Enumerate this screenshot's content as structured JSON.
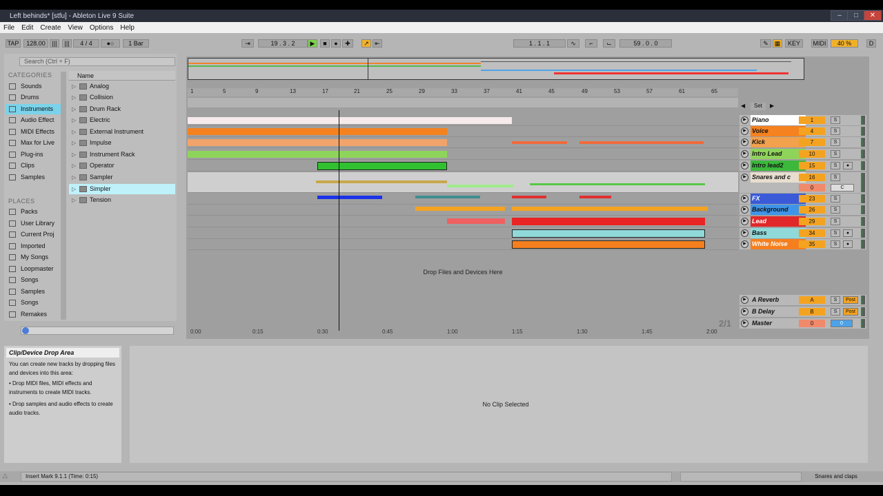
{
  "window": {
    "title": "Left behinds* [stfu] - Ableton Live 9 Suite"
  },
  "menu": [
    "File",
    "Edit",
    "Create",
    "View",
    "Options",
    "Help"
  ],
  "transport": {
    "tap": "TAP",
    "tempo": "128.00",
    "meter": "4 / 4",
    "quantize": "1 Bar",
    "position": "19 .  3 .  2",
    "loop_start": "1 .  1 .  1",
    "loop_length": "59 .  0 .  0",
    "key": "KEY",
    "midi": "MIDI",
    "cpu": "40 %",
    "disk": "D"
  },
  "browser": {
    "search_placeholder": "Search (Ctrl + F)",
    "categories_header": "CATEGORIES",
    "categories": [
      "Sounds",
      "Drums",
      "Instruments",
      "Audio Effect",
      "MIDI Effects",
      "Max for Live",
      "Plug-ins",
      "Clips",
      "Samples"
    ],
    "places_header": "PLACES",
    "places": [
      "Packs",
      "User Library",
      "Current Proj",
      "Imported",
      "My Songs",
      "Loopmaster",
      "Songs",
      "Samples",
      "Songs",
      "Remakes"
    ],
    "name_header": "Name",
    "items": [
      "Analog",
      "Collision",
      "Drum Rack",
      "Electric",
      "External Instrument",
      "Impulse",
      "Instrument Rack",
      "Operator",
      "Sampler",
      "Simpler",
      "Tension"
    ]
  },
  "arrangement": {
    "ruler_bars": [
      "1",
      "5",
      "9",
      "13",
      "17",
      "21",
      "25",
      "29",
      "33",
      "37",
      "41",
      "45",
      "49",
      "53",
      "57",
      "61",
      "65"
    ],
    "time_labels": [
      "0:00",
      "0:15",
      "0:30",
      "0:45",
      "1:00",
      "1:15",
      "1:30",
      "1:45",
      "2:00"
    ],
    "drop_hint": "Drop Files and Devices Here",
    "set_label": "Set",
    "zoom_label": "2/1"
  },
  "tracks": [
    {
      "name": "Piano",
      "num": "1",
      "color": "#ffffff"
    },
    {
      "name": "Voice",
      "num": "4",
      "color": "#f5821f"
    },
    {
      "name": "Kick",
      "num": "7",
      "color": "#f2a14c"
    },
    {
      "name": "Intro Lead",
      "num": "10",
      "color": "#8fd45a"
    },
    {
      "name": "Intro lead2",
      "num": "15",
      "color": "#3cb83c"
    },
    {
      "name": "Snares and c",
      "num": "16",
      "color": "#e8ded0"
    },
    {
      "name": "FX",
      "num": "23",
      "color": "#3a5ad8"
    },
    {
      "name": "Background",
      "num": "26",
      "color": "#3e94e8"
    },
    {
      "name": "Lead",
      "num": "29",
      "color": "#e0282a"
    },
    {
      "name": "Bass",
      "num": "34",
      "color": "#8fd9d9"
    },
    {
      "name": "White Noise",
      "num": "35",
      "color": "#f57f1e"
    }
  ],
  "returns": [
    {
      "name": "A Reverb",
      "num": "A",
      "post": "Post"
    },
    {
      "name": "B Delay",
      "num": "B",
      "post": "Post"
    },
    {
      "name": "Master",
      "num": "0",
      "post": "0"
    }
  ],
  "snares_sub": {
    "vol": "0",
    "pan": "C"
  },
  "info": {
    "title": "Clip/Device Drop Area",
    "intro": "You can create new tracks by dropping files and devices into this area:",
    "bullet1": "Drop MIDI files, MIDI effects and instruments to create MIDI tracks.",
    "bullet2": "Drop samples and audio effects to create audio tracks."
  },
  "detail": {
    "empty": "No Clip Selected"
  },
  "status": {
    "text": "Insert Mark 9.1.1 (Time: 0:15)",
    "right": "Snares and claps"
  }
}
